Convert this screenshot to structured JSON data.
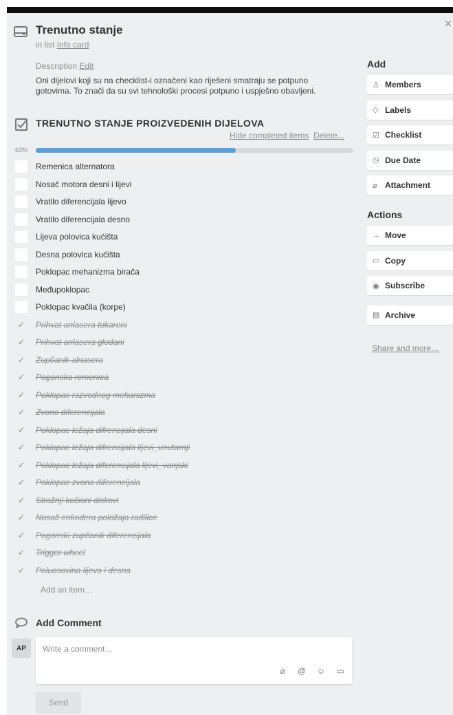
{
  "card": {
    "title": "Trenutno stanje",
    "in_list_prefix": "in list ",
    "list_name": "Info card",
    "description_label": "Description",
    "description_edit": "Edit",
    "description_text": "Oni dijelovi koji su na checklist-i označeni kao riješeni smatraju se potpuno gotovima. To znači da su svi tehnološki procesi potpuno i uspješno obavljeni.",
    "close_glyph": "×"
  },
  "checklist": {
    "title": "TRENUTNO STANJE PROIZVEDENIH DIJELOVA",
    "hide_completed": "Hide completed items",
    "delete": "Delete...",
    "progress_label": "63%",
    "progress": 0.63,
    "add_item": "Add an item…",
    "items": [
      {
        "text": "Remenica alternatora",
        "done": false
      },
      {
        "text": "Nosač motora desni i lijevi",
        "done": false
      },
      {
        "text": "Vratilo diferencijala lijevo",
        "done": false
      },
      {
        "text": "Vratilo diferencijala desno",
        "done": false
      },
      {
        "text": "Lijeva polovica kućišta",
        "done": false
      },
      {
        "text": "Desna polovica kućišta",
        "done": false
      },
      {
        "text": "Poklopac mehanizma birača",
        "done": false
      },
      {
        "text": "Međupoklopac",
        "done": false
      },
      {
        "text": "Poklopac kvačila (korpe)",
        "done": false
      },
      {
        "text": "Prihvat anlasera tokareni",
        "done": true
      },
      {
        "text": "Prihvat anlasera glodani",
        "done": true
      },
      {
        "text": "Zupčanik alnasera",
        "done": true
      },
      {
        "text": "Pogonska remenica",
        "done": true
      },
      {
        "text": "Poklopac razvodnog mehanizma",
        "done": true
      },
      {
        "text": "Zvono diferencijala",
        "done": true
      },
      {
        "text": "Poklopac ležaja difrencijala desni",
        "done": true
      },
      {
        "text": "Poklopac ležaja difrencijala lijevi_unutarnji",
        "done": true
      },
      {
        "text": "Poklopac ležaja diferencijala lijevi_vanjski",
        "done": true
      },
      {
        "text": "Poklopac zvona diferencijala",
        "done": true
      },
      {
        "text": "Stražnji kočioni diskovi",
        "done": true
      },
      {
        "text": "Nosač enkodera položaja radilice",
        "done": true
      },
      {
        "text": "Pogonski zupčanik diferencijala",
        "done": true
      },
      {
        "text": "Trigger wheel",
        "done": true
      },
      {
        "text": "Poluosovina lijeva i desna",
        "done": true
      }
    ]
  },
  "comment": {
    "heading": "Add Comment",
    "avatar_initials": "AP",
    "placeholder": "Write a comment…",
    "send_label": "Send",
    "tool_icons": [
      "attachment-icon",
      "mention-icon",
      "emoji-icon",
      "card-icon"
    ]
  },
  "sidebar": {
    "add_heading": "Add",
    "add_buttons": [
      {
        "label": "Members",
        "icon": "person-icon"
      },
      {
        "label": "Labels",
        "icon": "label-icon"
      },
      {
        "label": "Checklist",
        "icon": "checklist-icon"
      },
      {
        "label": "Due Date",
        "icon": "clock-icon"
      },
      {
        "label": "Attachment",
        "icon": "paperclip-icon"
      }
    ],
    "actions_heading": "Actions",
    "action_buttons": [
      {
        "label": "Move",
        "icon": "arrow-right-icon"
      },
      {
        "label": "Copy",
        "icon": "copy-icon"
      },
      {
        "label": "Subscribe",
        "icon": "eye-icon"
      },
      {
        "label": "Archive",
        "icon": "archive-icon"
      }
    ],
    "share_link": "Share and more…"
  },
  "colors": {
    "background": "#edeff0",
    "progress_fill": "#5aa0d8",
    "progress_track": "#d6dadc",
    "muted_text": "#8c8c8c"
  }
}
